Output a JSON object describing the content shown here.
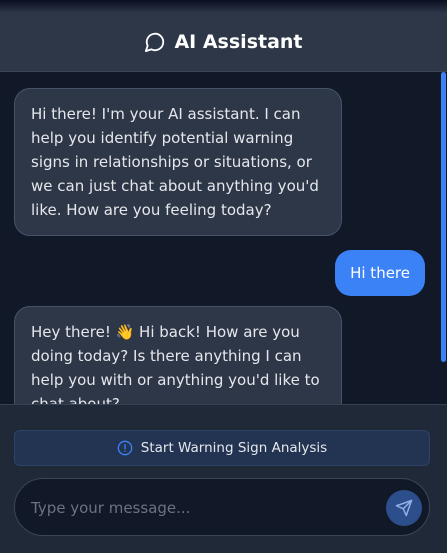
{
  "header": {
    "title": "AI Assistant",
    "icon": "chat-bubble-icon"
  },
  "messages": [
    {
      "role": "assistant",
      "text": "Hi there! I'm your AI assistant. I can help you identify potential warning signs in relationships or situations, or we can just chat about anything you'd like. How are you feeling today?"
    },
    {
      "role": "user",
      "text": "Hi there"
    },
    {
      "role": "assistant",
      "text": "Hey there! 👋 Hi back! How are you doing today? Is there anything I can help you with or anything you'd like to chat about?"
    }
  ],
  "footer": {
    "analysis_button_label": "Start Warning Sign Analysis",
    "analysis_icon": "alert-circle-icon",
    "input_placeholder": "Type your message...",
    "input_value": "",
    "send_icon": "send-icon"
  },
  "colors": {
    "accent": "#3b82f6",
    "background": "#111827",
    "header": "#2d3748",
    "bubble_ai": "#2d3748"
  }
}
